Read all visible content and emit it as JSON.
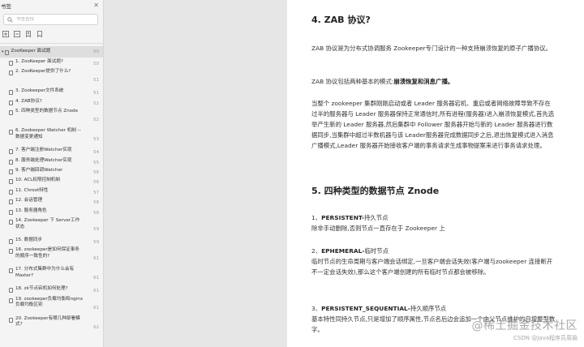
{
  "sidebar": {
    "title": "书签",
    "search_placeholder": "书签查找",
    "toc": [
      {
        "label": "ZooKeeper 面试题",
        "page": "50",
        "kind": "chapter"
      },
      {
        "label": "1. ZooKeeper 面试题?",
        "page": "50",
        "kind": "sub"
      },
      {
        "label": "2. ZooKeeper提供了什么?",
        "page": "51",
        "kind": "sub"
      },
      {
        "label": "3. Zookeeper文件系统",
        "page": "51",
        "kind": "sub"
      },
      {
        "label": "4. ZAB协议?",
        "page": "52",
        "kind": "sub"
      },
      {
        "label": "5. 四种类型的数据节点 Znode",
        "page": "52",
        "kind": "sub"
      },
      {
        "label": "6. Zookeeper Watcher 机制 -- 数据变更通知",
        "page": "53",
        "kind": "sub"
      },
      {
        "label": "7. 客户端注册Watcher实现",
        "page": "54",
        "kind": "sub"
      },
      {
        "label": "8. 服务端处理Watcher实现",
        "page": "55",
        "kind": "sub"
      },
      {
        "label": "9. 客户端回调Watcher",
        "page": "56",
        "kind": "sub"
      },
      {
        "label": "10. ACL权限控制机制",
        "page": "56",
        "kind": "sub"
      },
      {
        "label": "11. Chroot特性",
        "page": "57",
        "kind": "sub"
      },
      {
        "label": "12. 会话管理",
        "page": "58",
        "kind": "sub"
      },
      {
        "label": "13. 服务器角色",
        "page": "58",
        "kind": "sub"
      },
      {
        "label": "14. Zookeeper 下 Server工作状态",
        "page": "59",
        "kind": "sub"
      },
      {
        "label": "15. 数据同步",
        "page": "59",
        "kind": "sub"
      },
      {
        "label": "16. zookeeper是如何保证事务的顺序一致性的?",
        "page": "61",
        "kind": "sub"
      },
      {
        "label": "17. 分布式集群中为什么会有Master?",
        "page": "61",
        "kind": "sub"
      },
      {
        "label": "18. zk节点宕机如何处理?",
        "page": "61",
        "kind": "sub"
      },
      {
        "label": "19. zookeeper负载均衡和nginx负载均衡区别",
        "page": "61",
        "kind": "sub"
      },
      {
        "label": "20. Zookeeper有哪几种部署模式?",
        "page": "62",
        "kind": "sub"
      }
    ]
  },
  "document": {
    "h4": "4. ZAB 协议?",
    "p1": "ZAB 协议是为分布式协调服务 Zookeeper专门设计的一种支持崩溃恢复的原子广播协议。",
    "p2_pre": "ZAB 协议包括两种基本的模式:",
    "p2_bold": "崩溃恢复和消息广播。",
    "p3": "当整个 zookeeper 集群刚刚启动或者 Leader 服务器宕机、重启或者网络故障导致不存在过半的服务器与 Leader 服务器保持正常通信时,所有进程(服务器)进入崩溃恢复模式,首先选举产生新的 Leader 服务器,然后集群中 Follower 服务器开始与新的 Leader 服务器进行数据同步,当集群中超过半数机器与该 Leader服务器完成数据同步之后,退出恢复模式进入消息广播模式,Leader 服务器开始接收客户端的事务请求生成事物提案来进行事务请求处理。",
    "h5": "5. 四种类型的数据节点 Znode",
    "n1_prefix": "1、",
    "n1_title": "PERSISTENT-",
    "n1_suffix": "持久节点",
    "n1_desc": "除非手动删除,否则节点一直存在于 Zookeeper 上",
    "n2_prefix": "2、",
    "n2_title": "EPHEMERAL-",
    "n2_suffix": "临时节点",
    "n2_desc": "临时节点的生命周期与客户端会话绑定,一旦客户端会话失效(客户端与zookeeper 连接断开不一定会话失效),那么这个客户端创建的所有临时节点都会被移除。",
    "n3_prefix": "3、",
    "n3_title": "PERSISTENT_SEQUENTIAL-",
    "n3_suffix": "持久顺序节点",
    "n3_desc": "基本特性同持久节点,只是增加了顺序属性,节点名后边会追加一个由父节点维护的自增整型数字。"
  },
  "watermark": {
    "main": "@稀土掘金技术社区",
    "sub": "CSDN @Java程序员周瑜"
  },
  "icons": [
    "close-icon",
    "search-icon",
    "expand-all-icon",
    "collapse-all-icon",
    "add-bookmark-icon",
    "bookmark-icon",
    "document-icon",
    "collapse-caret-icon"
  ]
}
